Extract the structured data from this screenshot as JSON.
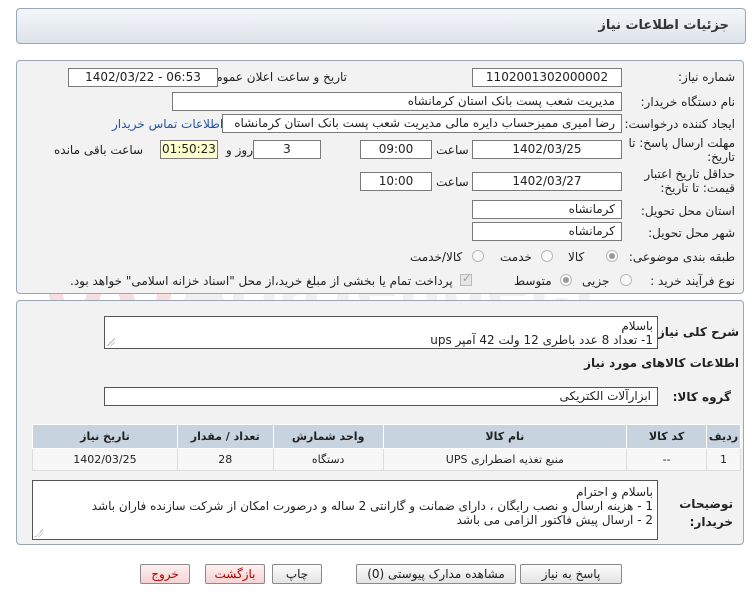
{
  "header": {
    "title": "جزئیات اطلاعات نیاز"
  },
  "fields": {
    "need_number_label": "شماره نیاز:",
    "need_number": "1102001302000002",
    "announce_label": "تاریخ و ساعت اعلان عمومی:",
    "announce_value": "1402/03/22 - 06:53",
    "buyer_org_label": "نام دستگاه خریدار:",
    "buyer_org": "مدیریت شعب پست بانک استان کرمانشاه",
    "requester_label": "ایجاد کننده درخواست:",
    "requester": "رضا امیری ممیزحساب دایره مالی مدیریت شعب پست بانک استان کرمانشاه",
    "contact_link": "اطلاعات تماس خریدار",
    "deadline_label": "مهلت ارسال پاسخ: تا تاریخ:",
    "deadline_date": "1402/03/25",
    "hour_label": "ساعت",
    "deadline_time": "09:00",
    "days_value": "3",
    "days_label": "روز و",
    "remaining_time": "01:50:23",
    "remaining_label": "ساعت باقی مانده",
    "validity_label": "حداقل تاریخ اعتبار قیمت: تا تاریخ:",
    "validity_date": "1402/03/27",
    "validity_hour_label": "ساعت",
    "validity_time": "10:00",
    "province_label": "استان محل تحویل:",
    "province": "کرمانشاه",
    "city_label": "شهر محل تحویل:",
    "city": "کرمانشاه",
    "category_label": "طبقه بندی موضوعی:",
    "category_options": [
      "کالا",
      "خدمت",
      "کالا/خدمت"
    ],
    "process_label": "نوع فرآیند خرید :",
    "process_options": [
      "جزیی",
      "متوسط"
    ],
    "payment_note": "پرداخت تمام یا بخشی از مبلغ خرید،از محل \"اسناد خزانه اسلامی\" خواهد بود."
  },
  "summary": {
    "label": "شرح کلی نیاز:",
    "line1": "باسلام",
    "line2": "1- تعداد 8 عدد باطری 12 ولت 42 آمپر ups"
  },
  "goods": {
    "section_title": "اطلاعات کالاهای مورد نیاز",
    "group_label": "گروه کالا:",
    "group_value": "ابزارآلات الکتریکی"
  },
  "table": {
    "headers": [
      "ردیف",
      "کد کالا",
      "نام کالا",
      "واحد شمارش",
      "تعداد / مقدار",
      "تاریخ نیاز"
    ],
    "rows": [
      [
        "1",
        "--",
        "منبع تغذیه اضطراری UPS",
        "دستگاه",
        "28",
        "1402/03/25"
      ]
    ]
  },
  "notes": {
    "label_line1": "توضیحات",
    "label_line2": "خریدار:",
    "line1": "باسلام و احترام",
    "line2": "1 - هزینه ارسال و نصب رایگان ، دارای ضمانت و گارانتی 2 ساله و درصورت امکان از شرکت سازنده فاران باشد",
    "line3": "2 - ارسال پیش فاکتور الزامی می باشد"
  },
  "buttons": {
    "reply": "پاسخ به نیاز",
    "attachments": "مشاهده مدارک پیوستی (0)",
    "print": "چاپ",
    "back": "بازگشت",
    "exit": "خروج"
  },
  "colors": {
    "header_bg": "#dde3ea",
    "table_header_bg": "#c8d3e0",
    "link": "#2255aa",
    "remaining_bg": "#ffffcc",
    "exit_text": "#b30000"
  }
}
